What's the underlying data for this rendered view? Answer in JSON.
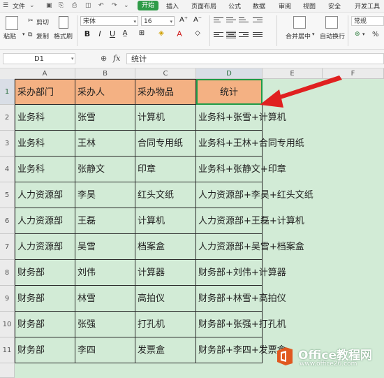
{
  "menu": {
    "file": "文件",
    "start": "开始",
    "items": [
      "插入",
      "页面布局",
      "公式",
      "数据",
      "审阅",
      "视图",
      "安全",
      "开发工具"
    ]
  },
  "toolbar": {
    "paste": "粘贴",
    "cut": "剪切",
    "copy": "复制",
    "format_painter": "格式刷",
    "font_name": "宋体",
    "font_size": "16",
    "bold": "B",
    "italic": "I",
    "underline": "U",
    "merge_center": "合并居中",
    "wrap_text": "自动换行",
    "number_format": "常规",
    "percent": "%"
  },
  "formula_bar": {
    "cell_ref": "D1",
    "fx": "fx",
    "content": "统计"
  },
  "columns": [
    "A",
    "B",
    "C",
    "D",
    "E",
    "F"
  ],
  "rows": [
    "1",
    "2",
    "3",
    "4",
    "5",
    "6",
    "7",
    "8",
    "9",
    "10",
    "11"
  ],
  "table": {
    "header": [
      "采办部门",
      "采办人",
      "采办物品",
      "统计"
    ],
    "data": [
      [
        "业务科",
        "张雪",
        "计算机",
        "业务科+张雪+计算机"
      ],
      [
        "业务科",
        "王林",
        "合同专用纸",
        "业务科+王林+合同专用纸"
      ],
      [
        "业务科",
        "张静文",
        "印章",
        "业务科+张静文+印章"
      ],
      [
        "人力资源部",
        "李昊",
        "红头文纸",
        "人力资源部+李昊+红头文纸"
      ],
      [
        "人力资源部",
        "王磊",
        "计算机",
        "人力资源部+王磊+计算机"
      ],
      [
        "人力资源部",
        "吴雪",
        "档案盒",
        "人力资源部+吴雪+档案盒"
      ],
      [
        "财务部",
        "刘伟",
        "计算器",
        "财务部+刘伟+计算器"
      ],
      [
        "财务部",
        "林雪",
        "高拍仪",
        "财务部+林雪+高拍仪"
      ],
      [
        "财务部",
        "张强",
        "打孔机",
        "财务部+张强+打孔机"
      ],
      [
        "财务部",
        "李四",
        "发票盒",
        "财务部+李四+发票盒"
      ]
    ]
  },
  "watermark": {
    "brand": "Office教程网",
    "url": "www.office26.com"
  },
  "colors": {
    "header_fill": "#f4b183",
    "sheet_bg": "#d2ebd6",
    "selection": "#1f9b47",
    "arrow": "#e02020",
    "start_tab": "#2f9b48"
  }
}
